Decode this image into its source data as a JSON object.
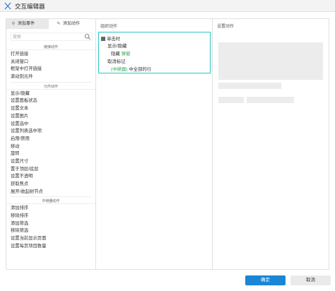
{
  "window": {
    "title": "交互编辑器"
  },
  "left": {
    "tab_events": "添加事件",
    "tab_actions": "添加动作",
    "search_placeholder": "搜索",
    "groups": [
      {
        "name": "链接动作",
        "items": [
          "打开链接",
          "关闭窗口",
          "框架中打开链接",
          "滚动到元件"
        ]
      },
      {
        "name": "元件动作",
        "items": [
          "显示/隐藏",
          "设置面板状态",
          "设置文本",
          "设置图片",
          "设置选中",
          "设置列表选中项",
          "启用/禁用",
          "移动",
          "旋转",
          "设置尺寸",
          "置于顶层/底层",
          "设置不透明",
          "获取焦点",
          "展开/收起树节点"
        ]
      },
      {
        "name": "中继器动作",
        "items": [
          "添加排序",
          "移除排序",
          "添加筛选",
          "移除筛选",
          "设置当前显示页面",
          "设置每页项目数量"
        ]
      }
    ]
  },
  "middle": {
    "header": "组织动作",
    "case": {
      "event": "单击时",
      "action1": "显示/隐藏",
      "action1_detail_prefix": "隐藏",
      "action1_target": "弹窗",
      "action2": "取消标记",
      "action2_target": "(中继器)",
      "action2_detail": "中全部的行"
    }
  },
  "right": {
    "header": "设置动作"
  },
  "footer": {
    "ok": "确定",
    "cancel": "取消"
  },
  "colors": {
    "accent": "#1a86d6",
    "case_border": "#2cc5c5",
    "target_green": "#2fa84f"
  }
}
